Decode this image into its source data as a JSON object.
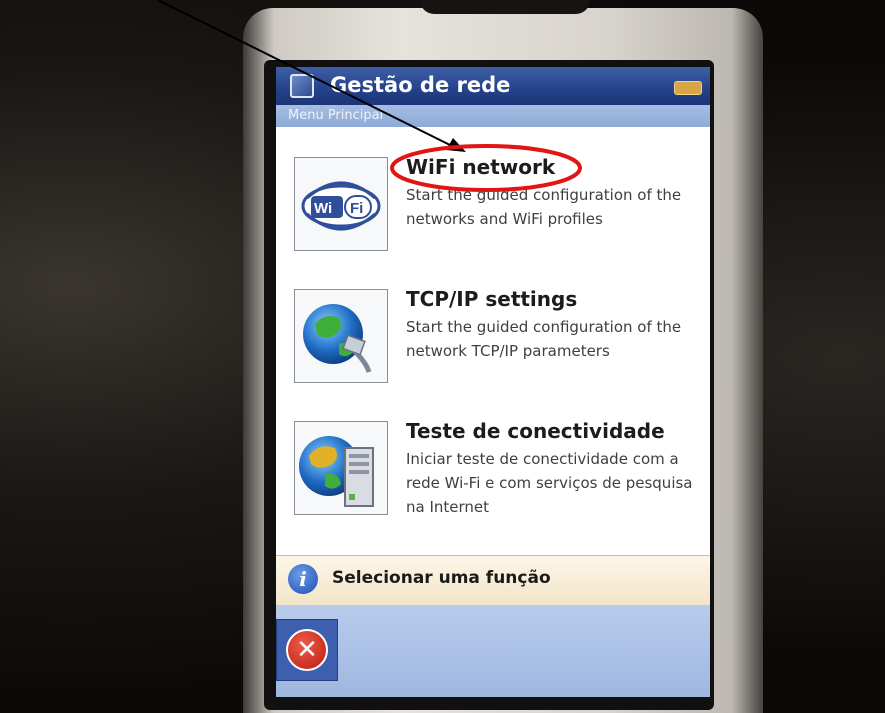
{
  "window": {
    "title": "Gestão de rede",
    "breadcrumb": "Menu Principal"
  },
  "menu": {
    "items": [
      {
        "title": "WiFi network",
        "description": "Start the guided configuration of the networks and WiFi profiles",
        "icon": "wifi-logo-icon"
      },
      {
        "title": "TCP/IP settings",
        "description": "Start the guided configuration of the network TCP/IP parameters",
        "icon": "globe-network-cable-icon"
      },
      {
        "title": "Teste de conectividade",
        "description": "Iniciar teste de conectividade com a rede Wi-Fi e com serviços de pesquisa na Internet",
        "icon": "globe-computer-tower-icon"
      }
    ]
  },
  "status": {
    "text": "Selecionar uma função",
    "icon": "info-icon"
  },
  "colors": {
    "title_bar": "#24418a",
    "highlight_ellipse": "#e01515",
    "annotation_arrow": "#000000"
  }
}
